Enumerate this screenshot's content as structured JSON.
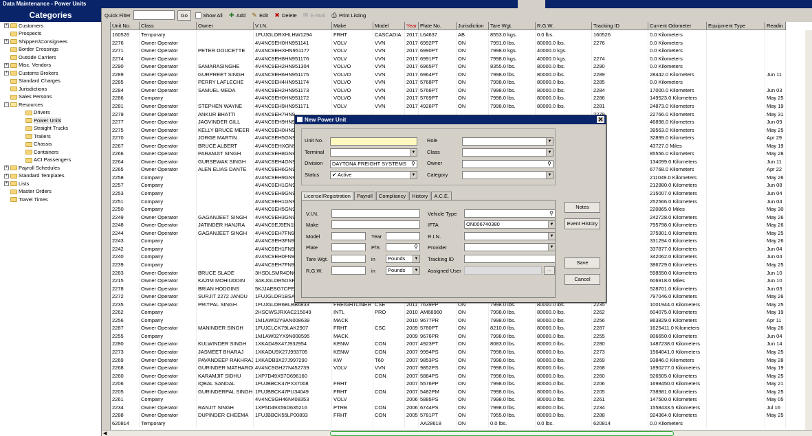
{
  "window": {
    "title": "Data Maintenance - Power Units"
  },
  "sidebar": {
    "heading": "Categories",
    "items": [
      {
        "label": "Customers",
        "expander": "+"
      },
      {
        "label": "Prospects",
        "expander": ""
      },
      {
        "label": "Shippers\\Consignees",
        "expander": "+"
      },
      {
        "label": "Border Crossings",
        "expander": ""
      },
      {
        "label": "Outside Carriers",
        "expander": ""
      },
      {
        "label": "Misc. Vendors",
        "expander": "+"
      },
      {
        "label": "Customs Brokers",
        "expander": "+"
      },
      {
        "label": "Standard Charges",
        "expander": ""
      },
      {
        "label": "Jurisdictions",
        "expander": ""
      },
      {
        "label": "Sales Persons",
        "expander": ""
      },
      {
        "label": "Resources",
        "expander": "−"
      },
      {
        "label": "Drivers",
        "expander": ""
      },
      {
        "label": "Power Units",
        "expander": ""
      },
      {
        "label": "Straight Trucks",
        "expander": ""
      },
      {
        "label": "Trailers",
        "expander": ""
      },
      {
        "label": "Chassis",
        "expander": ""
      },
      {
        "label": "Containers",
        "expander": ""
      },
      {
        "label": "ACI Passengers",
        "expander": ""
      },
      {
        "label": "Payroll Schedules",
        "expander": "+"
      },
      {
        "label": "Standard Templates",
        "expander": "+"
      },
      {
        "label": "Lists",
        "expander": "+"
      },
      {
        "label": "Master Orders",
        "expander": ""
      },
      {
        "label": "Travel Times",
        "expander": ""
      }
    ]
  },
  "toolbar": {
    "quick_filter_label": "Quick Filter",
    "quick_filter_value": "",
    "go_label": "Go",
    "show_all_label": "Show All",
    "add_label": "Add",
    "edit_label": "Edit",
    "delete_label": "Delete",
    "email_label": "E-Mail",
    "print_label": "Print Listing"
  },
  "grid": {
    "columns": [
      "Unit No.",
      "Class",
      "Owner",
      "V.I.N.",
      "Make",
      "Model",
      "Year",
      "Plate No.",
      "Jurisdiction",
      "Tare Wgt.",
      "R.G.W.",
      "Tracking ID",
      "Current Odometer",
      "Equipment Type",
      "Readin"
    ],
    "rows": [
      [
        "160526",
        "Temporary",
        "",
        "1FUJGLDRXHLHW1294",
        "FRHT",
        "CASCADIA",
        "2017",
        "L64637",
        "AB",
        "8553.0 kgs.",
        "0.0 lbs.",
        "160526",
        "0.0 Kilometers",
        "",
        ""
      ],
      [
        "2276",
        "Owner Operator",
        "",
        "4V4NC9EH0HN951141",
        "VOLV",
        "VVN",
        "2017",
        "6992PT",
        "ON",
        "7991.0 lbs.",
        "80000.0 lbs.",
        "2276",
        "0.0 Kilometers",
        "",
        ""
      ],
      [
        "2271",
        "Owner Operator",
        "PETER DOUCETTE",
        "4V4NC9EHXHN951177",
        "VOLV",
        "VVN",
        "2017",
        "6990PT",
        "ON",
        "7998.0 kgs.",
        "40000.0 kgs.",
        "",
        "0.0 Kilometers",
        "",
        ""
      ],
      [
        "2274",
        "Owner Operator",
        "",
        "4V4NC9EH8HN951176",
        "VOLV",
        "VVN",
        "2017",
        "6991PT",
        "ON",
        "7998.0 kgs.",
        "40000.0 kgs.",
        "2274",
        "0.0 Kilometers",
        "",
        ""
      ],
      [
        "2290",
        "Owner Operator",
        "SAMARASINGHE",
        "4V4NC9EH2HN951304",
        "VOLVO",
        "VVN",
        "2017",
        "6965PT",
        "ON",
        "8355.0 lbs.",
        "80000.0 lbs.",
        "2290",
        "0.0 Kilometers",
        "",
        ""
      ],
      [
        "2289",
        "Owner Operator",
        "GURPREET  SINGH",
        "4V4NC9EH6HN951175",
        "VOLVO",
        "VVN",
        "2017",
        "6964PT",
        "ON",
        "7998.0 lbs.",
        "80000.0 lbs.",
        "2289",
        "28442.0 Kilometers",
        "",
        "Jun 11"
      ],
      [
        "2285",
        "Owner Operator",
        "PERRY LAFLECHE",
        "4V4NC9EH4HN951174",
        "VOLVO",
        "VVN",
        "2017",
        "5768PT",
        "ON",
        "7998.0 lbs.",
        "80000.0 lbs.",
        "2285",
        "0.0 Kilometers",
        "",
        ""
      ],
      [
        "2284",
        "Owner Operator",
        "SAMUEL MEDA",
        "4V4NC9EH2HN951173",
        "VOLVO",
        "VVN",
        "2017",
        "5766PT",
        "ON",
        "7998.0 lbs.",
        "80000.0 lbs.",
        "2284",
        "17000.0 Kilometers",
        "",
        "Jun 03"
      ],
      [
        "2286",
        "Company",
        "",
        "4V4NC9EH0HN951172",
        "VOLVO",
        "VVN",
        "2017",
        "5769PT",
        "ON",
        "7998.0 lbs.",
        "80000.0 lbs.",
        "2286",
        "149523.0 Kilometers",
        "",
        "May 25"
      ],
      [
        "2281",
        "Owner Operator",
        "STEPHEN WAYNE",
        "4V4NC9EH9HN951171",
        "VOLV",
        "VVN",
        "2017",
        "4926PT",
        "ON",
        "7998.0 lbs.",
        "80000.0 lbs.",
        "2281",
        "24873.0 Kilometers",
        "",
        "May 19"
      ],
      [
        "2279",
        "Owner Operator",
        "ANKUR BHATTI",
        "4V4NC9EH7HN9",
        "",
        "",
        "",
        "",
        "",
        "",
        "",
        "2279",
        "22766.0 Kilometers",
        "",
        "May 31"
      ],
      [
        "2277",
        "Owner Operator",
        "JAGVINDER GILL",
        "4V4NC9EH9HN9",
        "",
        "",
        "",
        "",
        "",
        "",
        "",
        "2277",
        "46898.0 Kilometers",
        "",
        "Jun 09"
      ],
      [
        "2275",
        "Owner Operator",
        "KELLY BRUCE MEER",
        "4V4NC9EH0HN9",
        "",
        "",
        "",
        "",
        "",
        "",
        "",
        "2275",
        "39563.0 Kilometers",
        "",
        "May 25"
      ],
      [
        "2270",
        "Owner Operator",
        "JORGE MARTIN",
        "4V4NC9EH5GN9",
        "",
        "",
        "",
        "",
        "",
        "",
        "",
        "2270",
        "32899.0 Kilometers",
        "",
        "Apr 29"
      ],
      [
        "2267",
        "Owner Operator",
        "BRUCE ALBERT",
        "4V4NC9EHXGN9",
        "",
        "",
        "",
        "",
        "",
        "",
        "",
        "2267",
        "43727.0 Miles",
        "",
        "May 19"
      ],
      [
        "2266",
        "Owner Operator",
        "PARAMJIT SINGH",
        "4V4NC9EH8GN9",
        "",
        "",
        "",
        "",
        "",
        "",
        "",
        "2266",
        "85556.0 Kilometers",
        "",
        "May 28"
      ],
      [
        "2264",
        "Owner Operator",
        "GURSEWAK SINGH",
        "4V4NC9EH4GN9",
        "",
        "",
        "",
        "",
        "",
        "",
        "",
        "2264",
        "134099.0 Kilometers",
        "",
        "Jun 11"
      ],
      [
        "2265",
        "Owner Operator",
        "ALEN ELIAS DANTE",
        "4V4NC9EH6GN9",
        "",
        "",
        "",
        "",
        "",
        "",
        "",
        "2265",
        "67768.0 Kilometers",
        "",
        "Apr 22"
      ],
      [
        "2258",
        "Company",
        "",
        "4V4NC9EH9GN9",
        "",
        "",
        "",
        "",
        "",
        "",
        "",
        "2258",
        "211049.0 Kilometers",
        "",
        "May 26"
      ],
      [
        "2257",
        "Company",
        "",
        "4V4NC9EH1GN9",
        "",
        "",
        "",
        "",
        "",
        "",
        "",
        "2257",
        "212880.0 Kilometers",
        "",
        "Jun 08"
      ],
      [
        "2253",
        "Company",
        "",
        "4V4NC9EH9GN9",
        "",
        "",
        "",
        "",
        "",
        "",
        "",
        "2253",
        "215007.0 Kilometers",
        "",
        "Jun 04"
      ],
      [
        "2251",
        "Company",
        "",
        "4V4NC9EH1GN9",
        "",
        "",
        "",
        "",
        "",
        "",
        "",
        "2251",
        "252566.0 Kilometers",
        "",
        "Jun 04"
      ],
      [
        "2250",
        "Company",
        "",
        "4V4NC9EH5GN9",
        "",
        "",
        "",
        "",
        "",
        "",
        "",
        "2250",
        "220865.0 Miles",
        "",
        "May 30"
      ],
      [
        "2249",
        "Owner Operator",
        "GAGANJEET  SINGH",
        "4V4NC9EH3GN9",
        "",
        "",
        "",
        "",
        "",
        "",
        "",
        "2249",
        "242728.0 Kilometers",
        "",
        "May 26"
      ],
      [
        "2248",
        "Owner Operator",
        "JATINDER  HANJRA",
        "4V4NC9EJ5EN1E",
        "",
        "",
        "",
        "",
        "",
        "",
        "",
        "2248",
        "795798.0 Kilometers",
        "",
        "May 26"
      ],
      [
        "2244",
        "Owner Operator",
        "GAGANJEET  SINGH",
        "4V4NC9EH7FN9",
        "",
        "",
        "",
        "",
        "",
        "",
        "",
        "2244",
        "375901.0 Kilometers",
        "",
        "May 25"
      ],
      [
        "2243",
        "Company",
        "",
        "4V4NC9EH3FN9",
        "",
        "",
        "",
        "",
        "",
        "",
        "",
        "2243",
        "331294.0 Kilometers",
        "",
        "May 26"
      ],
      [
        "2242",
        "Company",
        "",
        "4V4NC9EH1FN9",
        "",
        "",
        "",
        "",
        "",
        "",
        "",
        "2242",
        "337877.0 Kilometers",
        "",
        "Jun 04"
      ],
      [
        "2240",
        "Company",
        "",
        "4V4NC9EH0FN9",
        "",
        "",
        "",
        "",
        "",
        "",
        "",
        "2240",
        "342062.0 Kilometers",
        "",
        "Jun 04"
      ],
      [
        "2239",
        "Company",
        "",
        "4V4NC9EH7FN9",
        "",
        "",
        "",
        "",
        "",
        "",
        "",
        "2239",
        "386729.0 Kilometers",
        "",
        "May 25"
      ],
      [
        "2283",
        "Owner Operator",
        "BRUCE SLADE",
        "3HSDLSMR4DN0",
        "",
        "",
        "",
        "",
        "",
        "",
        "",
        "2283",
        "598550.0 Kilometers",
        "",
        "Jun 10"
      ],
      [
        "2215",
        "Owner Operator",
        "KAZIM MOHIUDDIN",
        "3AKJGLDR5DSF",
        "",
        "",
        "",
        "",
        "",
        "",
        "",
        "2215",
        "606918.0 Miles",
        "",
        "Jun 10"
      ],
      [
        "2278",
        "Owner Operator",
        "BRIAN HODGINS",
        "5KJJAEBG7CPE",
        "",
        "",
        "",
        "",
        "",
        "",
        "",
        "2278",
        "528701.0 Kilometers",
        "",
        "Jun 03"
      ],
      [
        "2272",
        "Owner Operator",
        "SURJIT 2272 JANDU",
        "1FUJGLDR1BSA",
        "",
        "",
        "",
        "",
        "",
        "",
        "",
        "2272",
        "797046.0 Kilometers",
        "",
        "May 26"
      ],
      [
        "2235",
        "Owner Operator",
        "PRITPAL SINGH",
        "1FUJGLDR6BLBB6833",
        "FREIGHTLINER",
        "CSE",
        "2011",
        "7639PP",
        "ON",
        "7998.0 lbs.",
        "80000.0 lbs.",
        "2235",
        "1001944.0 Kilometers",
        "",
        "May 25"
      ],
      [
        "2262",
        "Company",
        "",
        "2HSCWSJRXAC215049",
        "INTL",
        "PRO",
        "2010",
        "AM68960",
        "ON",
        "7998.0 lbs.",
        "80000.0 lbs.",
        "2262",
        "604075.0 Kilometers",
        "",
        "May 19"
      ],
      [
        "2256",
        "Company",
        "",
        "1M1AW02Y9AN008639",
        "MACK",
        "",
        "2010",
        "9677PR",
        "ON",
        "7998.0 lbs.",
        "80000.0 lbs.",
        "2256",
        "863829.0 Kilometers",
        "",
        "Apr 11"
      ],
      [
        "2287",
        "Owner Operator",
        "MANINDER SINGH",
        "1FUJCLCK79LAK2907",
        "FRHT",
        "CSC",
        "2009",
        "5780PT",
        "ON",
        "8210.0 lbs.",
        "80000.0 lbs.",
        "2287",
        "1625411.0 Kilometers",
        "",
        "May 26"
      ],
      [
        "2255",
        "Company",
        "",
        "1M1AW02YX9N008595",
        "MACK",
        "",
        "2009",
        "9676PR",
        "ON",
        "7998.0 lbs.",
        "80000.0 lbs.",
        "2255",
        "806650.0 Kilometers",
        "",
        "Jun 04"
      ],
      [
        "2280",
        "Owner Operator",
        "KULWINDER SINGH",
        "1XKAD49X47J932954",
        "KENW",
        "CON",
        "2007",
        "4923PT",
        "ON",
        "8083.0 lbs.",
        "80000.0 lbs.",
        "2280",
        "1487238.0 Kilometers",
        "",
        "Jun 14"
      ],
      [
        "2273",
        "Owner Operator",
        "JASMEET BHARAJ",
        "1XKADU9X27J993705",
        "KENW",
        "CON",
        "2007",
        "9994PS",
        "ON",
        "7998.0 lbs.",
        "80000.0 lbs.",
        "2273",
        "1564041.0 Kilometers",
        "",
        "May 25"
      ],
      [
        "2269",
        "Owner Operator",
        "PAVANDEEP RAKHRAJ",
        "1XKADB9X27J997290",
        "KW",
        "T60",
        "2007",
        "9853PS",
        "ON",
        "7998.0 lbs.",
        "80000.0 lbs.",
        "2269",
        "93846.0 Kilometers",
        "",
        "May 28"
      ],
      [
        "2268",
        "Owner Operator",
        "GURINDER MATHAROO",
        "4V4NC9GH27N452739",
        "VOLV",
        "VVN",
        "2007",
        "9852PS",
        "ON",
        "7998.0 lbs.",
        "80000.0 lbs.",
        "2268",
        "1890277.0 Kilometers",
        "",
        "May 19"
      ],
      [
        "2260",
        "Owner Operator",
        "KARAMJIT  SIDHU",
        "1XP7D49X97D696160",
        "",
        "CON",
        "2007",
        "5884PS",
        "ON",
        "7998.0 lbs.",
        "80000.0 lbs.",
        "2260",
        "926505.0 Kilometers",
        "",
        "May 25"
      ],
      [
        "2206",
        "Owner Operator",
        "IQBAL  SANDAL",
        "1FUJBBCK47PX37008",
        "FRHT",
        "",
        "2007",
        "5576PP",
        "ON",
        "7998.0 lbs.",
        "80000.0 lbs.",
        "2206",
        "1698450.0 Kilometers",
        "",
        "May 21"
      ],
      [
        "2205",
        "Owner Operator",
        "GURINDERPAL SINGH",
        "1FUJBBCK47PU34049",
        "FRHT",
        "CON",
        "2007",
        "5482PM",
        "ON",
        "7998.0 lbs.",
        "80000.0 lbs.",
        "2205",
        "738981.0 Kilometers",
        "",
        "May 25"
      ],
      [
        "2261",
        "Company",
        "",
        "4V4NC9GH46N408353",
        "VOLV",
        "",
        "2006",
        "5885PS",
        "ON",
        "7998.0 lbs.",
        "80000.0 lbs.",
        "2261",
        "147500.0 Kilometers",
        "",
        "May 05"
      ],
      [
        "2234",
        "Owner Operator",
        "RANJIT SINGH",
        "1XP5D49X56D635216",
        "PTRB",
        "CON",
        "2006",
        "6744PS",
        "ON",
        "7998.0 lbs.",
        "80000.0 lbs.",
        "2234",
        "1558433.5 Kilometers",
        "",
        "Jul 16"
      ],
      [
        "2288",
        "Owner Operator",
        "DUPINDER CHEEMA",
        "1FUJBBCK55LP00893",
        "FRHT",
        "CON",
        "2005",
        "5781PT",
        "ON",
        "7955.0 lbs.",
        "80000.0 lbs.",
        "2288",
        "924364.0 Kilometers",
        "",
        "May 25"
      ],
      [
        "620814",
        "Temporary",
        "",
        "",
        "",
        "",
        "",
        "AA28618",
        "ON",
        "0.0 lbs.",
        "0.0 lbs.",
        "620814",
        "0.0 Kilometers",
        "",
        ""
      ]
    ]
  },
  "dialog": {
    "title": "New Power Unit",
    "unit_no_label": "Unit No.",
    "unit_no_value": "",
    "terminal_label": "Terminal",
    "terminal_value": "",
    "division_label": "Division",
    "division_value": "DAYTONA FREIGHT SYSTEMS",
    "status_label": "Status",
    "status_value": "Active",
    "role_label": "Role",
    "class_label": "Class",
    "owner_label": "Owner",
    "category_label": "Category",
    "tabs": [
      "License\\Registration",
      "Payroll",
      "Compliancy",
      "History",
      "A.C.E."
    ],
    "vin_label": "V.I.N.",
    "make_label": "Make",
    "model_label": "Model",
    "year_label": "Year",
    "plate_label": "Plate",
    "ps_label": "P/S",
    "tare_label": "Tare Wgt.",
    "in_label": "in",
    "tare_unit": "Pounds",
    "rgw_label": "R.G.W.",
    "rgw_unit": "Pounds",
    "vehicle_type_label": "Vehicle Type",
    "ifta_label": "IFTA",
    "ifta_value": "ON006740380",
    "rin_label": "R.I.N.",
    "provider_label": "Provider",
    "tracking_label": "Tracking ID",
    "assigned_user_label": "Assigned User",
    "ellipsis_label": "...",
    "notes_label": "Notes",
    "event_history_label": "Event History",
    "save_label": "Save",
    "cancel_label": "Cancel"
  }
}
